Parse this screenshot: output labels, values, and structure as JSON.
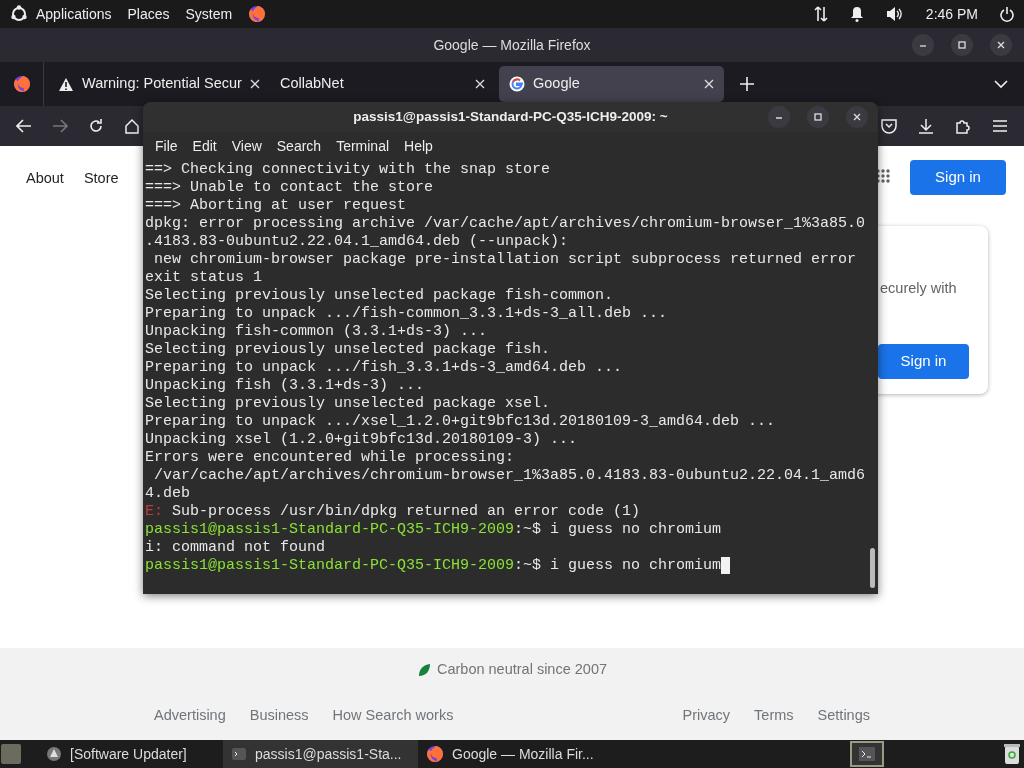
{
  "top_panel": {
    "menus": [
      "Applications",
      "Places",
      "System"
    ],
    "clock": "2:46 PM"
  },
  "browser": {
    "title": "Google — Mozilla Firefox",
    "tabs": [
      {
        "label": "Warning: Potential Secur",
        "kind": "warning",
        "selected": false
      },
      {
        "label": "CollabNet",
        "selected": false
      },
      {
        "label": "Google",
        "kind": "google",
        "selected": true
      }
    ],
    "page": {
      "nav_links": [
        "About",
        "Store"
      ],
      "sign_in": "Sign in",
      "card_text": "ecurely with",
      "card_button": "Sign in",
      "footer_note": "Carbon neutral since 2007",
      "footer_left": [
        "Advertising",
        "Business",
        "How Search works"
      ],
      "footer_right": [
        "Privacy",
        "Terms",
        "Settings"
      ]
    }
  },
  "terminal": {
    "title": "passis1@passis1-Standard-PC-Q35-ICH9-2009: ~",
    "menu": [
      "File",
      "Edit",
      "View",
      "Search",
      "Terminal",
      "Help"
    ],
    "lines": [
      {
        "text": "==> Checking connectivity with the snap store",
        "kind": "plain"
      },
      {
        "text": "===> Unable to contact the store",
        "kind": "plain"
      },
      {
        "text": "===> Aborting at user request",
        "kind": "plain"
      },
      {
        "text": "dpkg: error processing archive /var/cache/apt/archives/chromium-browser_1%3a85.0",
        "kind": "plain"
      },
      {
        "text": ".4183.83-0ubuntu2.22.04.1_amd64.deb (--unpack):",
        "kind": "plain"
      },
      {
        "text": " new chromium-browser package pre-installation script subprocess returned error",
        "kind": "plain"
      },
      {
        "text": "exit status 1",
        "kind": "plain"
      },
      {
        "text": "Selecting previously unselected package fish-common.",
        "kind": "plain"
      },
      {
        "text": "Preparing to unpack .../fish-common_3.3.1+ds-3_all.deb ...",
        "kind": "plain"
      },
      {
        "text": "Unpacking fish-common (3.3.1+ds-3) ...",
        "kind": "plain"
      },
      {
        "text": "Selecting previously unselected package fish.",
        "kind": "plain"
      },
      {
        "text": "Preparing to unpack .../fish_3.3.1+ds-3_amd64.deb ...",
        "kind": "plain"
      },
      {
        "text": "Unpacking fish (3.3.1+ds-3) ...",
        "kind": "plain"
      },
      {
        "text": "Selecting previously unselected package xsel.",
        "kind": "plain"
      },
      {
        "text": "Preparing to unpack .../xsel_1.2.0+git9bfc13d.20180109-3_amd64.deb ...",
        "kind": "plain"
      },
      {
        "text": "Unpacking xsel (1.2.0+git9bfc13d.20180109-3) ...",
        "kind": "plain"
      },
      {
        "text": "Errors were encountered while processing:",
        "kind": "plain"
      },
      {
        "text": " /var/cache/apt/archives/chromium-browser_1%3a85.0.4183.83-0ubuntu2.22.04.1_amd6",
        "kind": "plain"
      },
      {
        "text": "4.deb",
        "kind": "plain"
      },
      {
        "segments": [
          {
            "text": "E:",
            "kind": "error"
          },
          {
            "text": " Sub-process /usr/bin/dpkg returned an error code (1)",
            "kind": "plain"
          }
        ]
      },
      {
        "segments": [
          {
            "text": "passis1@passis1-Standard-PC-Q35-ICH9-2009",
            "kind": "prompt"
          },
          {
            "text": ":~$ i guess no chromium",
            "kind": "plain"
          }
        ]
      },
      {
        "text": "i: command not found",
        "kind": "plain"
      },
      {
        "segments": [
          {
            "text": "passis1@passis1-Standard-PC-Q35-ICH9-2009",
            "kind": "prompt"
          },
          {
            "text": ":~$ i guess no chromium",
            "kind": "plain"
          }
        ],
        "cursor": true
      }
    ]
  },
  "taskbar": {
    "items": [
      {
        "label": "[Software Updater]",
        "kind": "updater",
        "selected": false
      },
      {
        "label": "passis1@passis1-Sta...",
        "kind": "terminal",
        "selected": true
      },
      {
        "label": "Google — Mozilla Fir...",
        "kind": "firefox",
        "selected": false
      }
    ]
  }
}
